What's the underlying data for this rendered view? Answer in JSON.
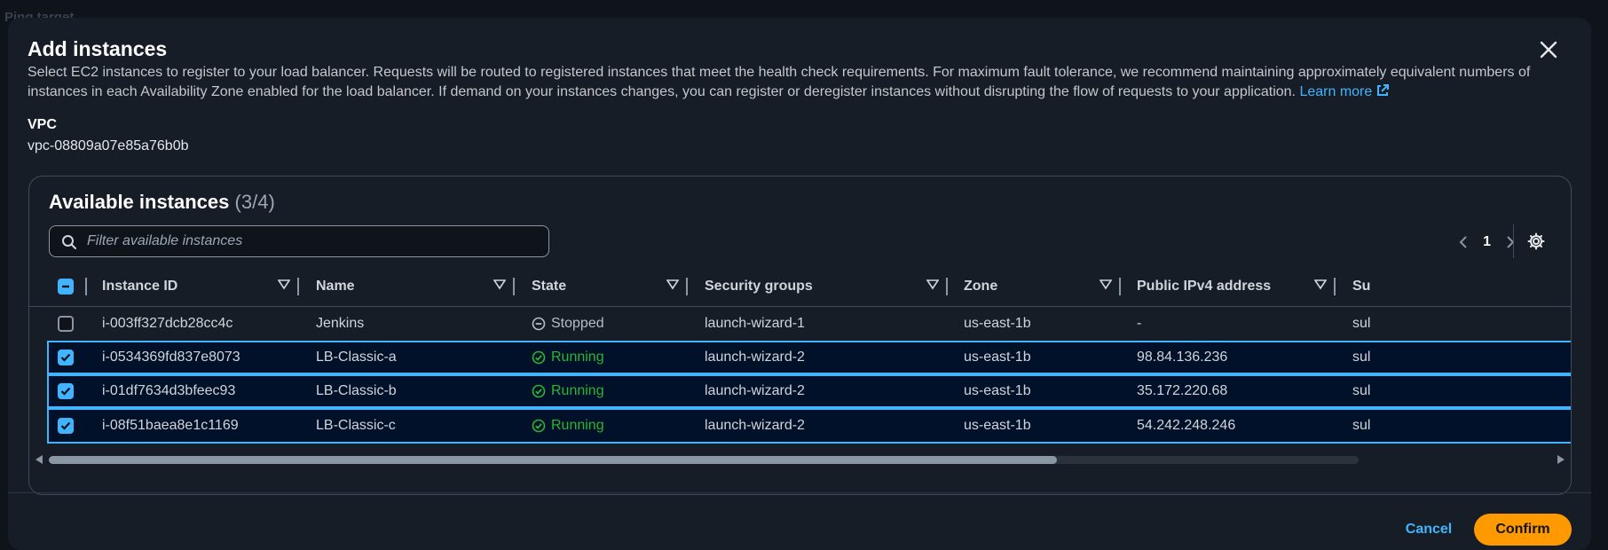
{
  "background": {
    "top_label": "Ping target"
  },
  "modal": {
    "title": "Add instances",
    "description": "Select EC2 instances to register to your load balancer. Requests will be routed to registered instances that meet the health check requirements. For maximum fault tolerance, we recommend maintaining approximately equivalent numbers of instances in each Availability Zone enabled for the load balancer. If demand on your instances changes, you can register or deregister instances without disrupting the flow of requests to your application.",
    "learn_more": "Learn more",
    "vpc_label": "VPC",
    "vpc_value": "vpc-08809a07e85a76b0b"
  },
  "table": {
    "title": "Available instances",
    "count": "(3/4)",
    "filter_placeholder": "Filter available instances",
    "page": "1",
    "columns": [
      "Instance ID",
      "Name",
      "State",
      "Security groups",
      "Zone",
      "Public IPv4 address",
      "Su"
    ],
    "rows": [
      {
        "selected": false,
        "instance_id": "i-003ff327dcb28cc4c",
        "name": "Jenkins",
        "state": "Stopped",
        "security_group": "launch-wizard-1",
        "zone": "us-east-1b",
        "ipv4": "-",
        "subnet": "sul"
      },
      {
        "selected": true,
        "instance_id": "i-0534369fd837e8073",
        "name": "LB-Classic-a",
        "state": "Running",
        "security_group": "launch-wizard-2",
        "zone": "us-east-1b",
        "ipv4": "98.84.136.236",
        "subnet": "sul"
      },
      {
        "selected": true,
        "instance_id": "i-01df7634d3bfeec93",
        "name": "LB-Classic-b",
        "state": "Running",
        "security_group": "launch-wizard-2",
        "zone": "us-east-1b",
        "ipv4": "35.172.220.68",
        "subnet": "sul"
      },
      {
        "selected": true,
        "instance_id": "i-08f51baea8e1c1169",
        "name": "LB-Classic-c",
        "state": "Running",
        "security_group": "launch-wizard-2",
        "zone": "us-east-1b",
        "ipv4": "54.242.248.246",
        "subnet": "sul"
      }
    ]
  },
  "footer": {
    "cancel": "Cancel",
    "confirm": "Confirm"
  },
  "colors": {
    "accent": "#42b4ff",
    "primary_button": "#ff9900",
    "running": "#2bb534",
    "modal_bg": "#161d26"
  },
  "icons": [
    "close-icon",
    "external-link-icon",
    "search-icon",
    "chevron-left-icon",
    "chevron-right-icon",
    "gear-icon",
    "sort-caret-icon",
    "check-circle-icon",
    "stop-circle-icon"
  ]
}
